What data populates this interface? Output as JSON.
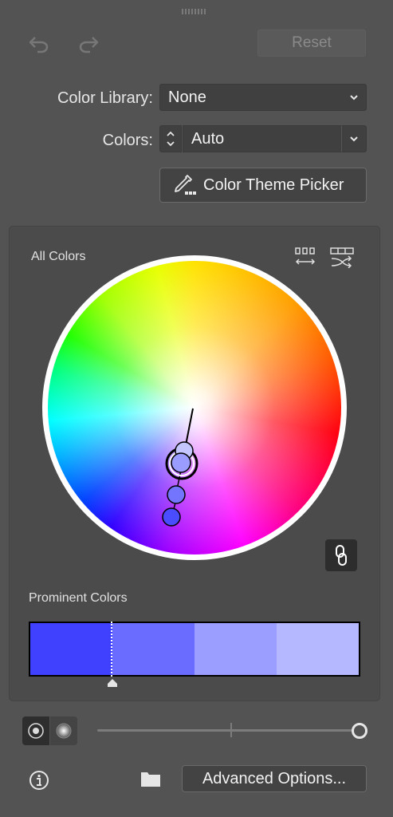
{
  "toolbar": {
    "undo_icon": "undo-icon",
    "redo_icon": "redo-icon",
    "reset_label": "Reset"
  },
  "color_library": {
    "label": "Color Library:",
    "value": "None"
  },
  "colors": {
    "label": "Colors:",
    "value": "Auto"
  },
  "theme_picker": {
    "label": "Color Theme Picker",
    "icon": "eyedropper-icon"
  },
  "harmony": {
    "section_label": "All Colors",
    "icons": [
      "distribute-evenly-icon",
      "randomize-colors-icon"
    ],
    "link_icon": "link-icon",
    "handles": [
      {
        "color": "#c4c6ff"
      },
      {
        "color": "#9a9cff"
      },
      {
        "color": "#7375ff"
      },
      {
        "color": "#4a4cff"
      }
    ]
  },
  "prominent": {
    "section_label": "Prominent Colors",
    "swatches": [
      "#4040ff",
      "#6a6cff",
      "#9b9dff",
      "#b6b8ff"
    ],
    "marker_icon": "slider-marker-icon"
  },
  "bottom": {
    "mode_icons": [
      "saturation-brightness-mode-icon",
      "hue-brightness-mode-icon"
    ],
    "slider_value": 1.0,
    "info_icon": "info-icon",
    "folder_icon": "folder-icon",
    "advanced_label": "Advanced Options..."
  }
}
